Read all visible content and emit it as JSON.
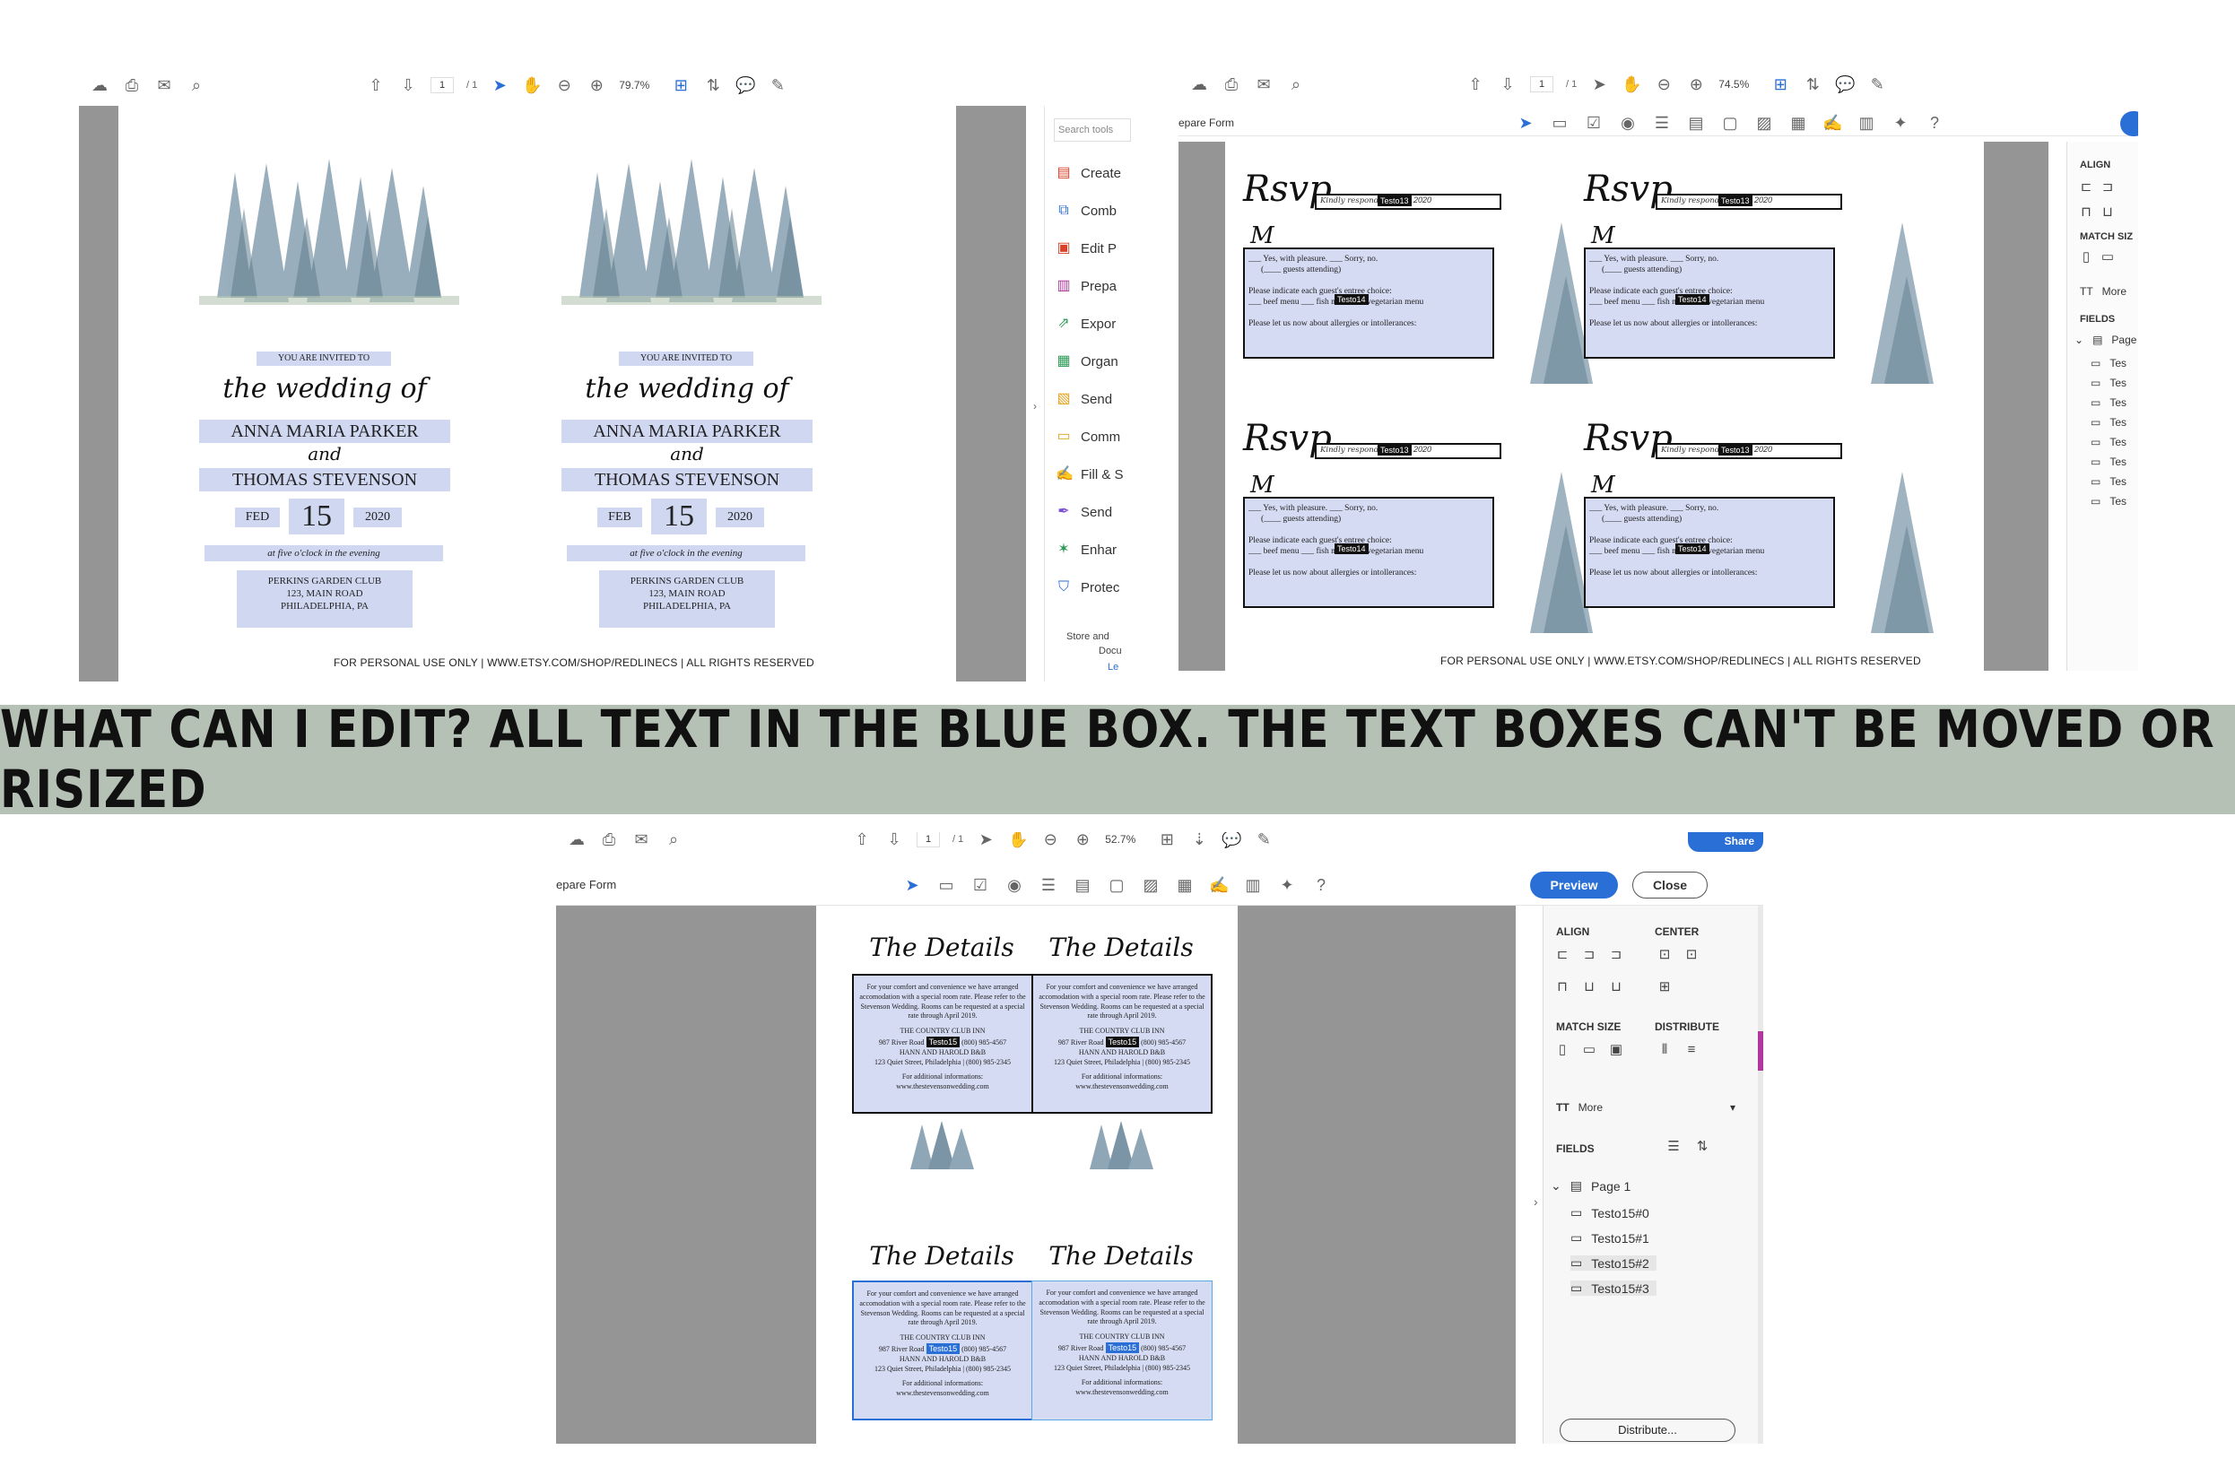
{
  "banner": {
    "text": "WHAT CAN I EDIT? ALL TEXT IN THE BLUE BOX. THE TEXT BOXES CAN'T BE MOVED OR RISIZED"
  },
  "shot1": {
    "page_indicator": "1",
    "page_total": "/ 1",
    "zoom": "79.7%",
    "search_placeholder": "Search tools",
    "tools": [
      "Create",
      "Comb",
      "Edit P",
      "Prepa",
      "Expor",
      "Organ",
      "Send",
      "Comm",
      "Fill & S",
      "Send",
      "Enhar",
      "Protec"
    ],
    "store_text_1": "Store and",
    "store_text_2": "Docu",
    "learn_link": "Le",
    "invite": {
      "invited": "YOU ARE INVITED TO",
      "wedding_of": "the wedding of",
      "name1": "ANNA MARIA PARKER",
      "and": "and",
      "name2": "THOMAS STEVENSON",
      "month_left": "FED",
      "month_right": "FEB",
      "day": "15",
      "year": "2020",
      "time": "at five o'clock in the evening",
      "venue1": "PERKINS GARDEN CLUB",
      "venue2": "123, MAIN ROAD",
      "venue3": "PHILADELPHIA, PA"
    },
    "footer": "FOR PERSONAL USE ONLY | WWW.ETSY.COM/SHOP/REDLINECS | ALL RIGHTS RESERVED"
  },
  "shot2": {
    "page_indicator": "1",
    "page_total": "/ 1",
    "zoom": "74.5%",
    "mode_label": "epare Form",
    "align": "ALIGN",
    "match_size": "MATCH SIZ",
    "more": "More",
    "fields": "FIELDS",
    "page": "Page",
    "field_items": [
      "Tes",
      "Tes",
      "Tes",
      "Tes",
      "Tes",
      "Tes",
      "Tes",
      "Tes"
    ],
    "rsvp": {
      "title": "Rsvp",
      "kindly": "Kindly respond by F",
      "kindly_year": "2020",
      "field_tag": "Testo13",
      "m": "M",
      "line1": "___ Yes, with pleasure.      ___ Sorry, no.",
      "line2": "(____ guests attending)",
      "line3": "Please indicate each guest's entree choice:",
      "line4": "___ beef menu   ___ fish menu   ___ vegetarian menu",
      "field_tag2": "Testo14",
      "line5": "Please let us now about allergies or intollerances:"
    },
    "footer": "FOR PERSONAL USE ONLY | WWW.ETSY.COM/SHOP/REDLINECS | ALL RIGHTS RESERVED"
  },
  "shot3": {
    "page_indicator": "1",
    "page_total": "/ 1",
    "zoom": "52.7%",
    "mode_label": "epare Form",
    "share": "Share",
    "preview": "Preview",
    "close": "Close",
    "align": "ALIGN",
    "center": "CENTER",
    "match_size": "MATCH SIZE",
    "distribute": "DISTRIBUTE",
    "more": "More",
    "fields": "FIELDS",
    "page": "Page 1",
    "field_items": [
      "Testo15#0",
      "Testo15#1",
      "Testo15#2",
      "Testo15#3"
    ],
    "distribute_btn": "Distribute...",
    "details": {
      "title": "The Details",
      "p1": "For your comfort and convenience we have arranged accomodation with a special room rate. Please refer to the Stevenson Wedding. Rooms can be requested at a special rate through April 2019.",
      "inn": "THE COUNTRY CLUB INN",
      "inn_addr": "987 River Road",
      "inn_phone": "(800) 985-4567",
      "field_tag": "Testo15",
      "bb": "HANN AND HAROLD B&B",
      "bb_addr": "123 Quiet Street, Philadelphia | (800) 985-2345",
      "info": "For additional informations:",
      "site": "www.thestevensonwedding.com"
    }
  },
  "colors": {
    "accent": "#2a6fd6",
    "blue_box": "#cfd7f1",
    "banner": "#b6c1b6",
    "grey": "#959595"
  }
}
